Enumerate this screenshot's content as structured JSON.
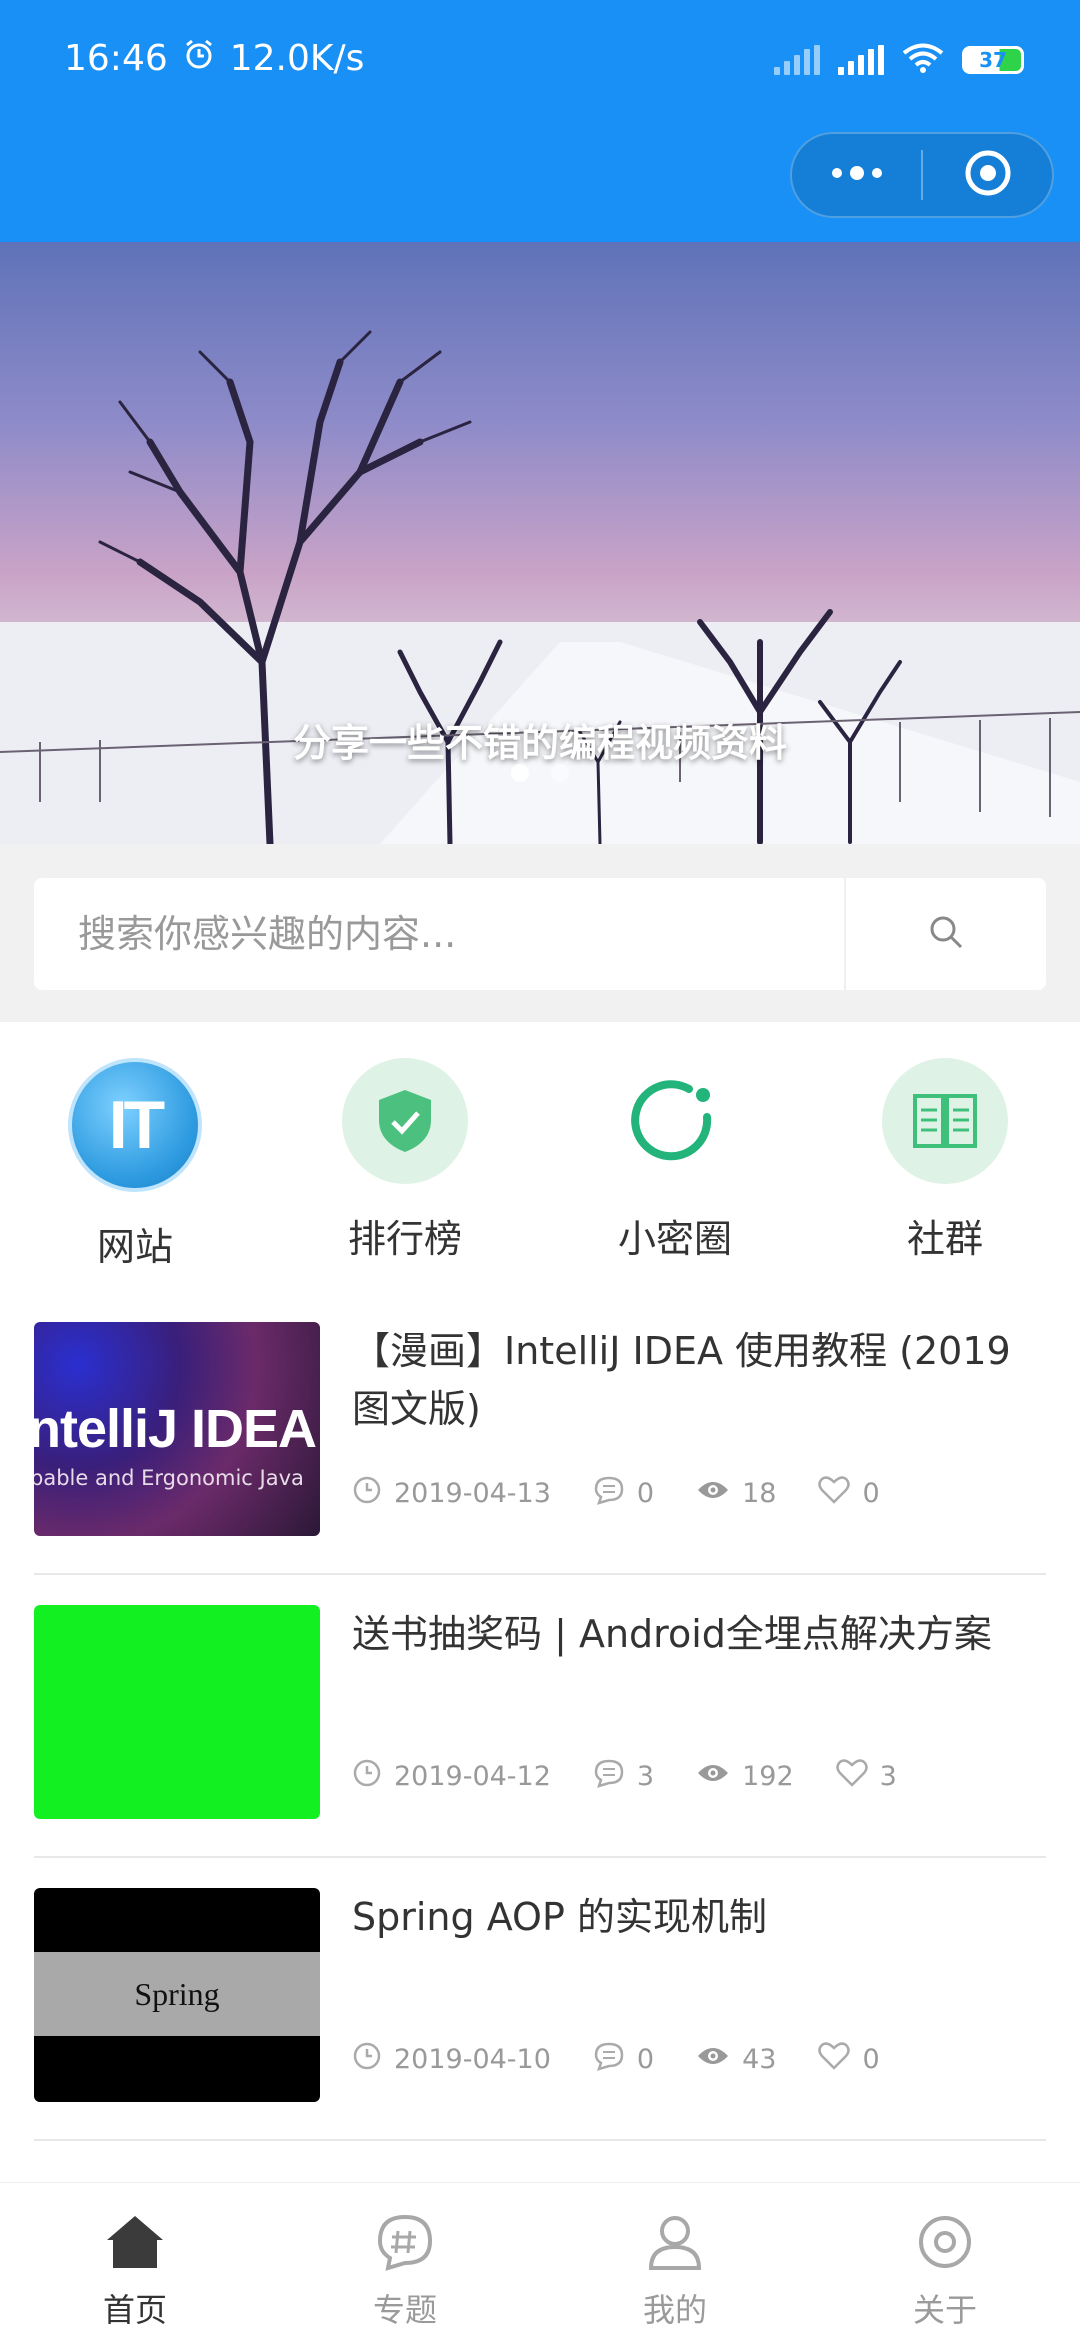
{
  "status_bar": {
    "time": "16:46",
    "speed": "12.0K/s",
    "battery": "37",
    "icons": [
      "alarm-icon",
      "signal-icon",
      "wifi-icon",
      "battery-icon"
    ]
  },
  "capsule": {
    "menu_icon": "more-dots-icon",
    "close_icon": "target-icon"
  },
  "banner": {
    "caption": "分享一些不错的编程视频资料",
    "slide_count": 2,
    "active_index": 0
  },
  "search": {
    "placeholder": "搜索你感兴趣的内容..."
  },
  "categories": [
    {
      "label": "网站",
      "icon": "it-icon",
      "color": "#3aa4e8"
    },
    {
      "label": "排行榜",
      "icon": "shield-check-icon",
      "color": "#3ec07a"
    },
    {
      "label": "小密圈",
      "icon": "circle-dot-icon",
      "color": "#22b47a"
    },
    {
      "label": "社群",
      "icon": "book-icon",
      "color": "#3ec07a"
    }
  ],
  "articles": [
    {
      "title": "【漫画】IntelliJ IDEA 使用教程 (2019图文版)",
      "date": "2019-04-13",
      "comments": "0",
      "views": "18",
      "likes": "0",
      "thumb_text_main": "ntelliJ IDEA",
      "thumb_text_sub": "pable and Ergonomic Java"
    },
    {
      "title": "送书抽奖码 | Android全埋点解决方案",
      "date": "2019-04-12",
      "comments": "3",
      "views": "192",
      "likes": "3"
    },
    {
      "title": "Spring AOP 的实现机制",
      "date": "2019-04-10",
      "comments": "0",
      "views": "43",
      "likes": "0",
      "thumb_text_main": "Spring"
    }
  ],
  "tabbar": [
    {
      "label": "首页",
      "icon": "home-icon",
      "active": true
    },
    {
      "label": "专题",
      "icon": "topic-icon",
      "active": false
    },
    {
      "label": "我的",
      "icon": "user-icon",
      "active": false
    },
    {
      "label": "关于",
      "icon": "about-icon",
      "active": false
    }
  ],
  "colors": {
    "header": "#1890f5",
    "accent": "#3ec07a",
    "text": "#333333",
    "muted": "#999999"
  }
}
